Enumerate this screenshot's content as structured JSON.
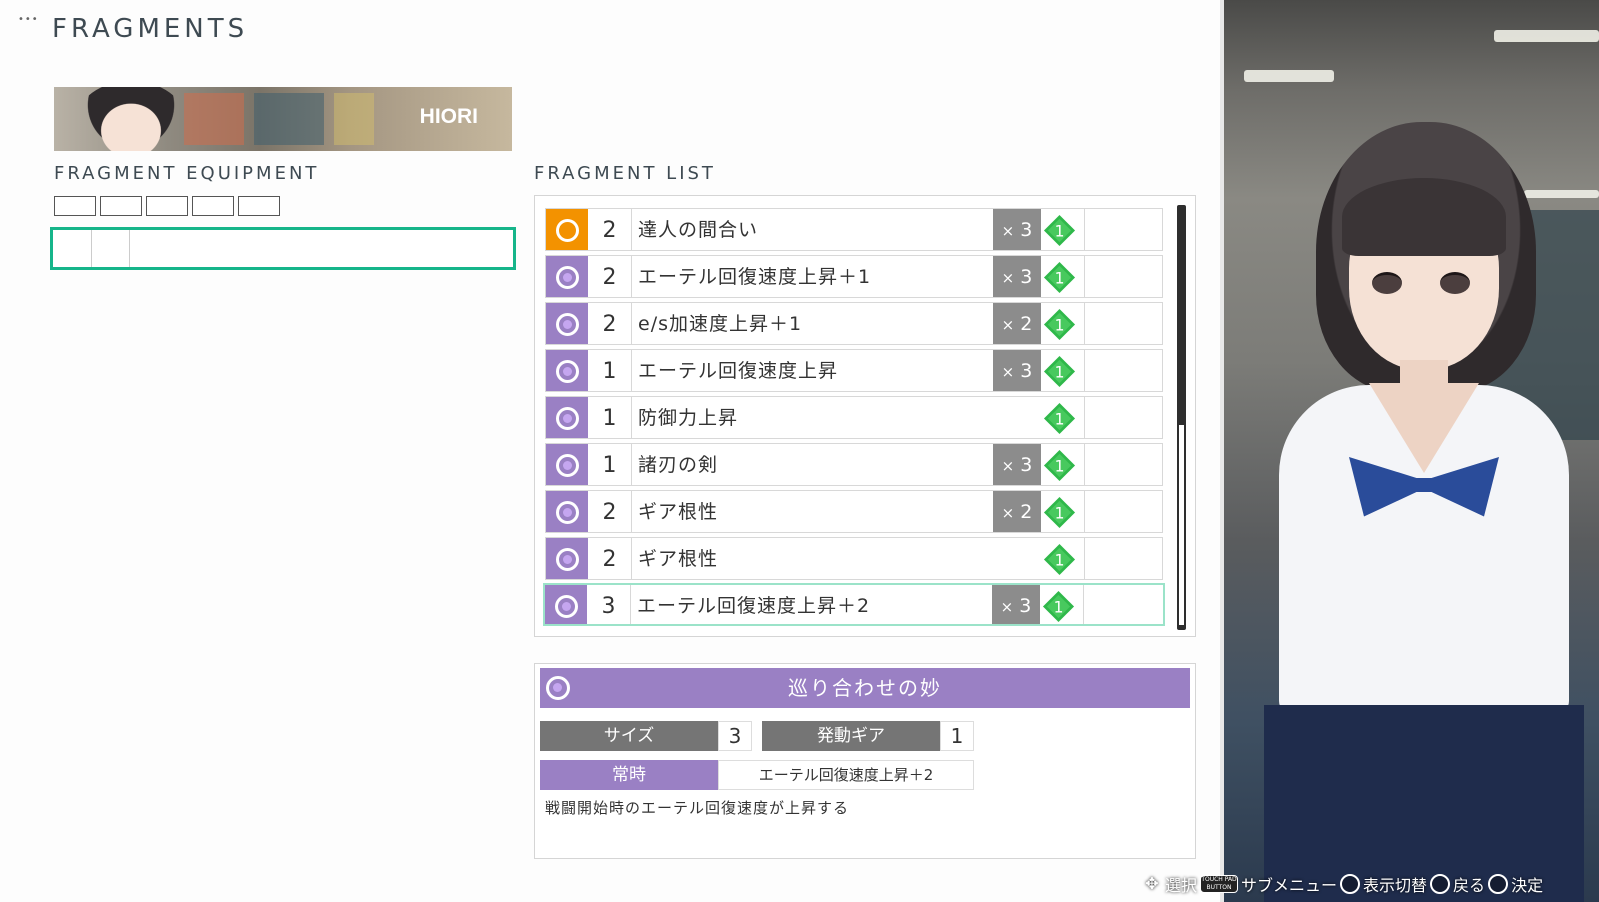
{
  "header": {
    "title": "FRAGMENTS",
    "menu_dots": "•••"
  },
  "character": {
    "name": "HIORI"
  },
  "equipment": {
    "label": "FRAGMENT EQUIPMENT",
    "slot_count": 5
  },
  "list": {
    "label": "FRAGMENT LIST",
    "items": [
      {
        "icon": "orange-ring-icon",
        "size": "2",
        "name": "達人の間合い",
        "count": "3",
        "gear": "1"
      },
      {
        "icon": "purple-ring-icon",
        "size": "2",
        "name": "エーテル回復速度上昇＋1",
        "count": "3",
        "gear": "1"
      },
      {
        "icon": "purple-ring-icon",
        "size": "2",
        "name": "e/s加速度上昇＋1",
        "count": "2",
        "gear": "1"
      },
      {
        "icon": "purple-ring-icon",
        "size": "1",
        "name": "エーテル回復速度上昇",
        "count": "3",
        "gear": "1"
      },
      {
        "icon": "purple-ring-icon",
        "size": "1",
        "name": "防御力上昇",
        "count": "",
        "gear": "1"
      },
      {
        "icon": "purple-ring-icon",
        "size": "1",
        "name": "諸刃の剣",
        "count": "3",
        "gear": "1"
      },
      {
        "icon": "purple-ring-icon",
        "size": "2",
        "name": "ギア根性",
        "count": "2",
        "gear": "1"
      },
      {
        "icon": "purple-ring-icon",
        "size": "2",
        "name": "ギア根性",
        "count": "",
        "gear": "1"
      },
      {
        "icon": "purple-ring-icon",
        "size": "3",
        "name": "エーテル回復速度上昇＋2",
        "count": "3",
        "gear": "1"
      }
    ],
    "selected_index": 8
  },
  "detail": {
    "title": "巡り合わせの妙",
    "size_label": "サイズ",
    "size_value": "3",
    "gear_label": "発動ギア",
    "gear_value": "1",
    "effect_label": "常時",
    "effect_value": "エーテル回復速度上昇＋2",
    "description": "戦闘開始時のエーテル回復速度が上昇する"
  },
  "hints": {
    "select": "選択",
    "submenu": "サブメニュー",
    "toggle_display": "表示切替",
    "back": "戻る",
    "confirm": "決定",
    "touchpad_line1": "TOUCH PAD",
    "touchpad_line2": "BUTTON"
  },
  "colors": {
    "accent_purple": "#9a80c4",
    "accent_orange": "#f39200",
    "accent_green": "#16b58a",
    "gear_green": "#2fb84a"
  }
}
